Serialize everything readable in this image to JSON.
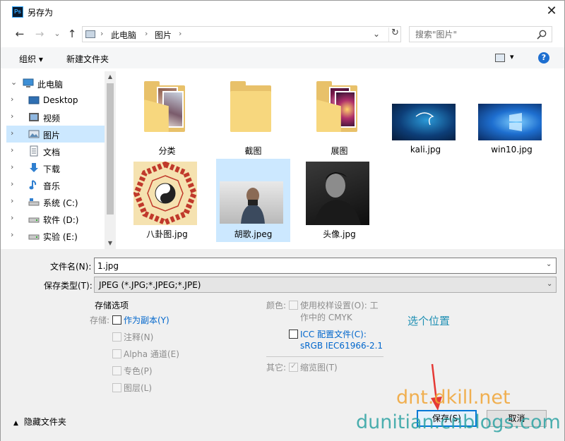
{
  "window": {
    "title": "另存为",
    "app_icon_text": "Ps",
    "close_glyph": "✕"
  },
  "nav": {
    "back_glyph": "←",
    "forward_glyph": "→",
    "recent_glyph": "⌄",
    "up_glyph": "↑"
  },
  "address": {
    "crumbs": [
      "此电脑",
      "图片"
    ],
    "separators": [
      "›",
      "›",
      "›"
    ],
    "dropdown_glyph": "⌄",
    "refresh_glyph": "↻"
  },
  "search": {
    "placeholder": "搜索\"图片\""
  },
  "toolbar": {
    "organize": "组织 ▾",
    "new_folder": "新建文件夹",
    "view_dropdown": "▾",
    "help": "?"
  },
  "sidebar": {
    "items": [
      {
        "label": "此电脑",
        "chevron": "⌄"
      },
      {
        "label": "Desktop",
        "chevron": "›"
      },
      {
        "label": "视频",
        "chevron": "›"
      },
      {
        "label": "图片",
        "chevron": "›"
      },
      {
        "label": "文档",
        "chevron": "›"
      },
      {
        "label": "下载",
        "chevron": "›"
      },
      {
        "label": "音乐",
        "chevron": "›"
      },
      {
        "label": "系统 (C:)",
        "chevron": "›"
      },
      {
        "label": "软件 (D:)",
        "chevron": "›"
      },
      {
        "label": "实验 (E:)",
        "chevron": "›"
      }
    ],
    "scroll_up": "▲",
    "scroll_down": "▼"
  },
  "files": [
    {
      "name": "分类"
    },
    {
      "name": "截图"
    },
    {
      "name": "展图"
    },
    {
      "name": "kali.jpg"
    },
    {
      "name": "win10.jpg"
    },
    {
      "name": "八卦图.jpg"
    },
    {
      "name": "胡歌.jpeg"
    },
    {
      "name": "头像.jpg"
    }
  ],
  "form": {
    "filename_label": "文件名(N):",
    "filename_value": "1.jpg",
    "filetype_label": "保存类型(T):",
    "filetype_value": "JPEG (*.JPG;*.JPEG;*.JPE)",
    "dropdown_glyph": "⌄"
  },
  "options": {
    "header": "存储选项",
    "save_label": "存储:",
    "as_copy": "作为副本(Y)",
    "notes": "注释(N)",
    "alpha": "Alpha 通道(E)",
    "spot": "专色(P)",
    "layers": "图层(L)",
    "color_label": "颜色:",
    "use_proof_1": "使用校样设置(O):  工",
    "use_proof_2": "作中的 CMYK",
    "icc_1": "ICC 配置文件(C):",
    "icc_2": "sRGB IEC61966-2.1",
    "other_label": "其它:",
    "thumbnail": "缩览图(T)",
    "pick_location": "选个位置"
  },
  "buttons": {
    "save": "保存(S)",
    "cancel": "取消",
    "hide_folders": "隐藏文件夹",
    "hide_glyph": "▲"
  },
  "watermark": {
    "line1": "dnt.dkill.net",
    "line2": "dunitian.cnblogs.com"
  },
  "colors": {
    "selection": "#cce8ff",
    "link": "#0066cc",
    "accent": "#0078d7",
    "annotation": "#1e8fb3",
    "wm_orange": "#f1a435",
    "wm_teal": "#2ea3a3"
  }
}
